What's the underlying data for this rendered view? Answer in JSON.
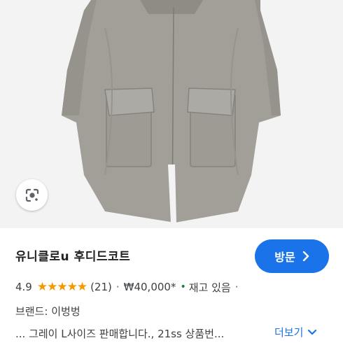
{
  "product": {
    "title": "유니클로u 후디드코트",
    "visit_label": "방문",
    "rating": "4.9",
    "stars": "★★★★★",
    "review_count": "(21)",
    "price": "₩40,000*",
    "stock_dot": "•",
    "stock": "재고 있음",
    "separator": "·",
    "brand": "브랜드: 이벙벙",
    "description": "... 그레이 L사이즈 판매합니다., 21ss 상품번...",
    "more_label": "더보기"
  },
  "colors": {
    "accent": "#1a73e8",
    "star": "#f29900",
    "stock": "#188038",
    "coat": "#a29f99"
  },
  "icons": {
    "lens": "google-lens-icon",
    "visit_arrow": "chevron-right-icon",
    "more_arrow": "chevron-down-icon"
  }
}
